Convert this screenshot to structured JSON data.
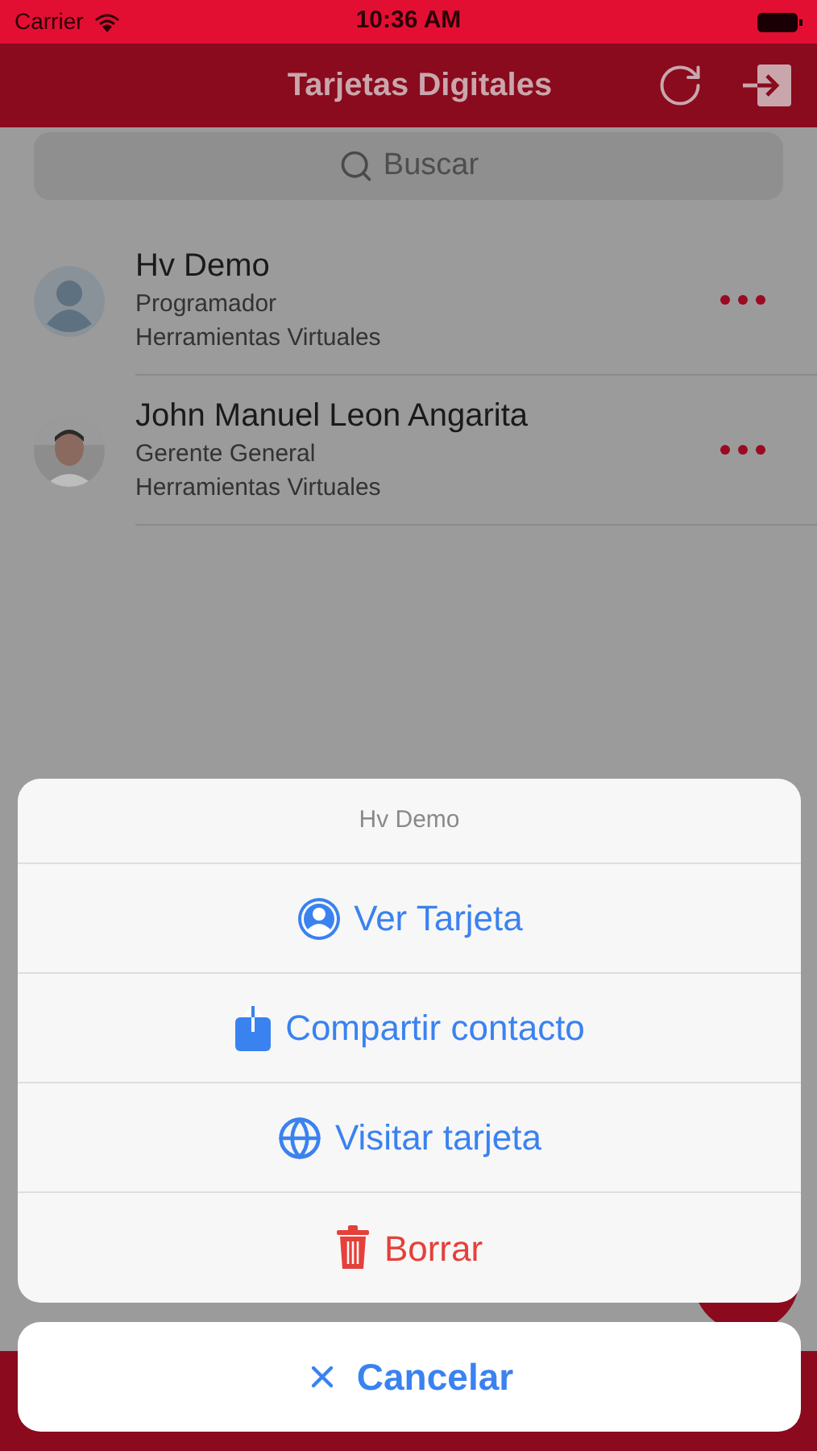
{
  "status_bar": {
    "carrier": "Carrier",
    "time": "10:36 AM"
  },
  "nav": {
    "title": "Tarjetas Digitales"
  },
  "search": {
    "placeholder": "Buscar"
  },
  "contacts": [
    {
      "name": "Hv Demo",
      "role": "Programador",
      "company": "Herramientas Virtuales"
    },
    {
      "name": "John Manuel Leon Angarita",
      "role": "Gerente General",
      "company": "Herramientas Virtuales",
      "kind": "picture"
    }
  ],
  "action_sheet": {
    "title": "Hv Demo",
    "actions": [
      {
        "label": "Ver Tarjeta",
        "kind": "view"
      },
      {
        "label": "Compartir contacto",
        "kind": "share"
      },
      {
        "label": "Visitar tarjeta",
        "kind": "visit"
      },
      {
        "label": "Borrar",
        "kind": "delete"
      }
    ],
    "cancel": "Cancelar"
  }
}
